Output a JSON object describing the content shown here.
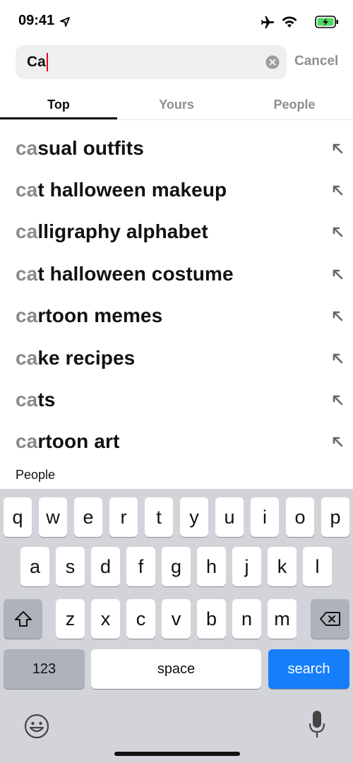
{
  "status_bar": {
    "time": "09:41",
    "icons": [
      "location-arrow-icon",
      "airplane-icon",
      "wifi-icon",
      "battery-charging-icon"
    ]
  },
  "search": {
    "value": "Ca",
    "clear_icon": "clear-circle-icon",
    "cancel_label": "Cancel",
    "caret_color": "#e60023"
  },
  "tabs": [
    {
      "label": "Top",
      "active": true
    },
    {
      "label": "Yours",
      "active": false
    },
    {
      "label": "People",
      "active": false
    }
  ],
  "suggestions": [
    {
      "match": "ca",
      "rest": "sual outfits"
    },
    {
      "match": "ca",
      "rest": "t halloween makeup"
    },
    {
      "match": "ca",
      "rest": "lligraphy alphabet"
    },
    {
      "match": "ca",
      "rest": "t halloween costume"
    },
    {
      "match": "ca",
      "rest": "rtoon memes"
    },
    {
      "match": "ca",
      "rest": "ke recipes"
    },
    {
      "match": "ca",
      "rest": "ts"
    },
    {
      "match": "ca",
      "rest": "rtoon art"
    }
  ],
  "section_label": "People",
  "keyboard": {
    "row1": [
      "q",
      "w",
      "e",
      "r",
      "t",
      "y",
      "u",
      "i",
      "o",
      "p"
    ],
    "row2": [
      "a",
      "s",
      "d",
      "f",
      "g",
      "h",
      "j",
      "k",
      "l"
    ],
    "row3": [
      "z",
      "x",
      "c",
      "v",
      "b",
      "n",
      "m"
    ],
    "numbers_label": "123",
    "space_label": "space",
    "search_label": "search",
    "accent_color": "#147efb"
  }
}
